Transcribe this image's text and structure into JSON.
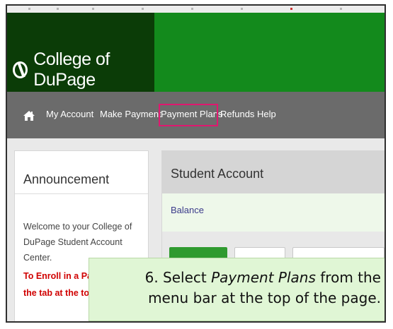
{
  "header": {
    "logo_icon": "college-of-dupage-logo-icon",
    "brand": "College of DuPage"
  },
  "nav": {
    "home_icon": "home-icon",
    "items": [
      {
        "label": "My Account"
      },
      {
        "label": "Make Payment"
      },
      {
        "label": "Payment Plans",
        "highlighted": true
      },
      {
        "label": "Refunds"
      },
      {
        "label": "Help"
      }
    ],
    "highlight_color": "#e0176f"
  },
  "announcement": {
    "title": "Announcement",
    "welcome": "Welcome to your College of DuPage Student Account Center.",
    "enroll_line1": "To Enroll in a Pay",
    "enroll_line2": "the tab at the top"
  },
  "student_account": {
    "title": "Student Account",
    "separator": "I",
    "balance_label": "Balance"
  },
  "callout": {
    "prefix": "6. Select ",
    "emphasis": "Payment Plans",
    "suffix": " from the",
    "line2": "menu bar at the top of the page."
  },
  "colors": {
    "header_dark": "#0b3c07",
    "header_green": "#138a1c",
    "navbar": "#6b6b6b",
    "callout_bg": "#e0f6d5",
    "alert_red": "#d00000"
  }
}
